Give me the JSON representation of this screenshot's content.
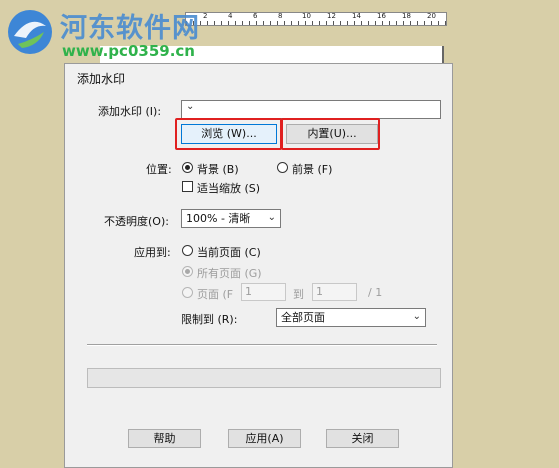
{
  "watermark": {
    "title": "河东软件网",
    "url": "www.pc0359.cn"
  },
  "ruler": {
    "numbers": [
      "2",
      "4",
      "6",
      "8",
      "10",
      "12",
      "14",
      "16",
      "18",
      "20"
    ]
  },
  "dialog": {
    "title": "添加水印",
    "add_watermark_label": "添加水印 (I):",
    "add_watermark_value": "",
    "browse_button": "浏览 (W)...",
    "builtin_button": "内置(U)...",
    "position_label": "位置:",
    "background_option": "背景 (B)",
    "foreground_option": "前景 (F)",
    "scale_checkbox": "适当缩放 (S)",
    "opacity_label": "不透明度(O):",
    "opacity_value": "100% - 清晰",
    "apply_to_label": "应用到:",
    "current_page_option": "当前页面 (C)",
    "all_pages_option": "所有页面 (G)",
    "pages_option": "页面 (F",
    "page_from": "1",
    "to_label": "到",
    "page_to": "1",
    "page_total": "/ 1",
    "limit_label": "限制到 (R):",
    "limit_value": "全部页面",
    "help_button": "帮助",
    "apply_button": "应用(A)",
    "close_button": "关闭"
  },
  "colors": {
    "highlight": "#e02020",
    "watermark_blue": "#4a8cd0",
    "watermark_green": "#2fb24b"
  }
}
